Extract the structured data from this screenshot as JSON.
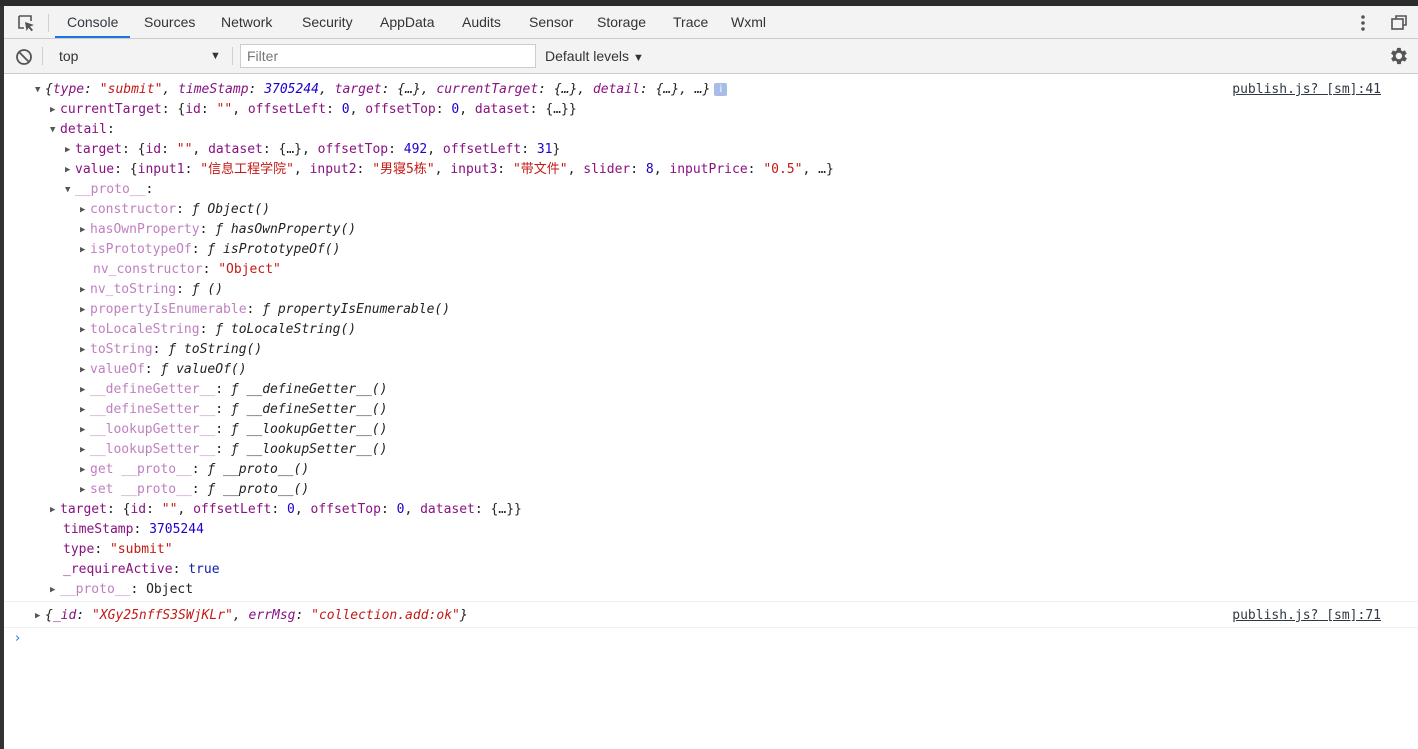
{
  "tabs": [
    {
      "label": "Console",
      "active": true
    },
    {
      "label": "Sources"
    },
    {
      "label": "Network"
    },
    {
      "label": "Security"
    },
    {
      "label": "AppData"
    },
    {
      "label": "Audits"
    },
    {
      "label": "Sensor"
    },
    {
      "label": "Storage"
    },
    {
      "label": "Trace"
    },
    {
      "label": "Wxml"
    }
  ],
  "toolbar": {
    "context": "top",
    "filter_placeholder": "Filter",
    "levels": "Default levels"
  },
  "colors": {
    "accent": "#1a73e8",
    "string": "#c41a16",
    "number": "#1c00cf",
    "key": "#881280",
    "key_dim": "#c080c0"
  },
  "icons": [
    "inspect-icon",
    "kebab-menu-icon",
    "undock-icon",
    "clear-console-icon",
    "gear-icon",
    "info-icon",
    "prompt-chevron-icon"
  ],
  "console": {
    "entry1": {
      "source": "publish.js? [sm]:41",
      "summary": {
        "k_type": "type",
        "v_type": "\"submit\"",
        "k_ts": "timeStamp",
        "v_ts": "3705244",
        "k_target": "target",
        "v_target": "{…}",
        "k_ct": "currentTarget",
        "v_ct": "{…}",
        "k_detail": "detail",
        "v_detail": "{…}",
        "more": "…"
      },
      "info_badge": "i",
      "currentTarget": {
        "key": "currentTarget",
        "k_id": "id",
        "v_id": "\"\"",
        "k_ol": "offsetLeft",
        "v_ol": "0",
        "k_ot": "offsetTop",
        "v_ot": "0",
        "k_ds": "dataset",
        "v_ds": "{…}"
      },
      "detail": {
        "key": "detail",
        "target": {
          "key": "target",
          "k_id": "id",
          "v_id": "\"\"",
          "k_ds": "dataset",
          "v_ds": "{…}",
          "k_ot": "offsetTop",
          "v_ot": "492",
          "k_ol": "offsetLeft",
          "v_ol": "31"
        },
        "value": {
          "key": "value",
          "k_i1": "input1",
          "v_i1": "\"信息工程学院\"",
          "k_i2": "input2",
          "v_i2": "\"男寝5栋\"",
          "k_i3": "input3",
          "v_i3": "\"带文件\"",
          "k_sl": "slider",
          "v_sl": "8",
          "k_ip": "inputPrice",
          "v_ip": "\"0.5\"",
          "more": "…"
        },
        "proto_key": "__proto__",
        "proto": [
          {
            "key": "constructor",
            "value": "ƒ Object()",
            "expandable": true
          },
          {
            "key": "hasOwnProperty",
            "value": "ƒ hasOwnProperty()",
            "expandable": true
          },
          {
            "key": "isPrototypeOf",
            "value": "ƒ isPrototypeOf()",
            "expandable": true
          },
          {
            "key": "nv_constructor",
            "value": "\"Object\"",
            "expandable": false
          },
          {
            "key": "nv_toString",
            "value": "ƒ ()",
            "expandable": true
          },
          {
            "key": "propertyIsEnumerable",
            "value": "ƒ propertyIsEnumerable()",
            "expandable": true
          },
          {
            "key": "toLocaleString",
            "value": "ƒ toLocaleString()",
            "expandable": true
          },
          {
            "key": "toString",
            "value": "ƒ toString()",
            "expandable": true
          },
          {
            "key": "valueOf",
            "value": "ƒ valueOf()",
            "expandable": true
          },
          {
            "key": "__defineGetter__",
            "value": "ƒ __defineGetter__()",
            "expandable": true
          },
          {
            "key": "__defineSetter__",
            "value": "ƒ __defineSetter__()",
            "expandable": true
          },
          {
            "key": "__lookupGetter__",
            "value": "ƒ __lookupGetter__()",
            "expandable": true
          },
          {
            "key": "__lookupSetter__",
            "value": "ƒ __lookupSetter__()",
            "expandable": true
          },
          {
            "key": "get __proto__",
            "value": "ƒ __proto__()",
            "expandable": true
          },
          {
            "key": "set __proto__",
            "value": "ƒ __proto__()",
            "expandable": true
          }
        ]
      },
      "target": {
        "key": "target",
        "k_id": "id",
        "v_id": "\"\"",
        "k_ol": "offsetLeft",
        "v_ol": "0",
        "k_ot": "offsetTop",
        "v_ot": "0",
        "k_ds": "dataset",
        "v_ds": "{…}"
      },
      "timeStamp": {
        "key": "timeStamp",
        "value": "3705244"
      },
      "type": {
        "key": "type",
        "value": "\"submit\""
      },
      "requireActive": {
        "key": "_requireActive",
        "value": "true"
      },
      "proto": {
        "key": "__proto__",
        "value": "Object"
      }
    },
    "entry2": {
      "source": "publish.js? [sm]:71",
      "k_id": "_id",
      "v_id": "\"XGy25nffS3SWjKLr\"",
      "k_msg": "errMsg",
      "v_msg": "\"collection.add:ok\""
    }
  }
}
